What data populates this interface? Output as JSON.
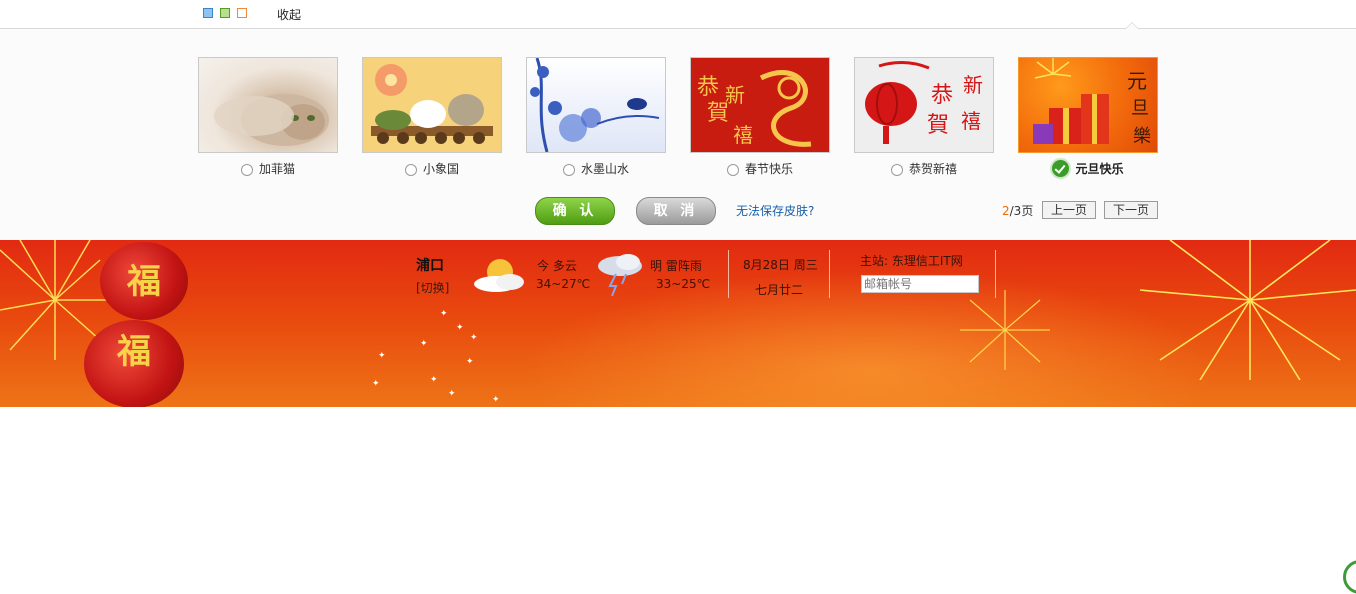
{
  "topbar": {
    "color_swatches": [
      "blue",
      "green",
      "orange"
    ],
    "collapse_label": "收起"
  },
  "skins": {
    "items": [
      {
        "label": "加菲猫",
        "selected": false
      },
      {
        "label": "小象国",
        "selected": false
      },
      {
        "label": "水墨山水",
        "selected": false
      },
      {
        "label": "春节快乐",
        "selected": false
      },
      {
        "label": "恭贺新禧",
        "selected": false
      },
      {
        "label": "元旦快乐",
        "selected": true
      }
    ],
    "confirm_label": "确 认",
    "cancel_label": "取 消",
    "help_link": "无法保存皮肤?",
    "pager": {
      "current": "2",
      "total_text": "/3页",
      "prev_label": "上一页",
      "next_label": "下一页"
    }
  },
  "banner": {
    "city": "浦口",
    "switch_label": "[切换]",
    "today": {
      "label": "今 多云",
      "temp": "34~27℃",
      "icon": "cloudy-sun-icon"
    },
    "tomorrow": {
      "label": "明 雷阵雨",
      "temp": "33~25℃",
      "icon": "thunderstorm-icon"
    },
    "date": "8月28日 周三",
    "lunar_date": "七月廿二",
    "site_label": "主站: 东理信工IT网",
    "mail_placeholder": "邮箱帐号",
    "lantern_char": "福"
  },
  "colors": {
    "accent": "#f39a2b",
    "banner_red": "#e22a12",
    "confirm_green": "#4f9d12",
    "link_blue": "#1a5fa8"
  }
}
